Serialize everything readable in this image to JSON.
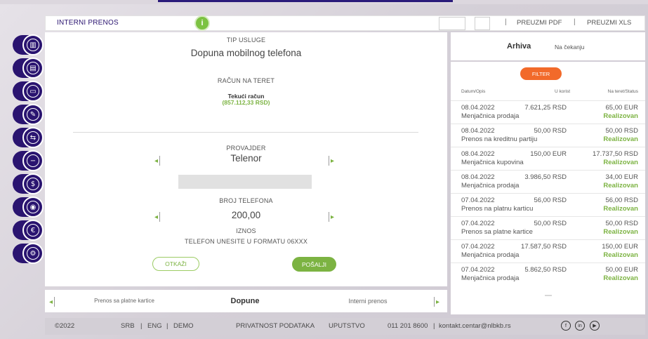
{
  "header": {
    "title": "INTERNI PRENOS",
    "info_icon": "i",
    "separator": "|",
    "download_pdf": "PREUZMI PDF",
    "download_xls": "PREUZMI XLS"
  },
  "form": {
    "service_type_label": "TIP USLUGE",
    "service_type_value": "Dopuna mobilnog telefona",
    "debit_account_label": "RAČUN NA TERET",
    "account_name": "Tekući račun",
    "account_balance": "(857.112,33 RSD)",
    "provider_label": "PROVAJDER",
    "provider_value": "Telenor",
    "phone_label": "BROJ TELEFONA",
    "amount_value": "200,00",
    "amount_label": "IZNOS",
    "phone_hint": "TELEFON UNESITE U FORMATU 06XXX",
    "cancel_label": "OTKAŽI",
    "send_label": "POŠALJI"
  },
  "carousel": {
    "prev_item": "Prenos sa platne kartice",
    "current_item": "Dopune",
    "next_item": "Interni prenos"
  },
  "archive": {
    "tab_active": "Arhiva",
    "tab_inactive": "Na čekanju",
    "filter_label": "FILTER",
    "col_date": "Datum/Opis",
    "col_credit": "U korist",
    "col_debit": "Na teret/Status",
    "transactions": [
      {
        "date": "08.04.2022",
        "credit": "7.621,25 RSD",
        "debit": "65,00 EUR",
        "desc": "Menjačnica prodaja",
        "status": "Realizovan"
      },
      {
        "date": "08.04.2022",
        "credit": "50,00 RSD",
        "debit": "50,00 RSD",
        "desc": "Prenos na kreditnu partiju",
        "status": "Realizovan"
      },
      {
        "date": "08.04.2022",
        "credit": "150,00 EUR",
        "debit": "17.737,50 RSD",
        "desc": "Menjačnica kupovina",
        "status": "Realizovan"
      },
      {
        "date": "08.04.2022",
        "credit": "3.986,50 RSD",
        "debit": "34,00 EUR",
        "desc": "Menjačnica prodaja",
        "status": "Realizovan"
      },
      {
        "date": "07.04.2022",
        "credit": "56,00 RSD",
        "debit": "56,00 RSD",
        "desc": "Prenos na platnu karticu",
        "status": "Realizovan"
      },
      {
        "date": "07.04.2022",
        "credit": "50,00 RSD",
        "debit": "50,00 RSD",
        "desc": "Prenos sa platne kartice",
        "status": "Realizovan"
      },
      {
        "date": "07.04.2022",
        "credit": "17.587,50 RSD",
        "debit": "150,00 EUR",
        "desc": "Menjačnica prodaja",
        "status": "Realizovan"
      },
      {
        "date": "07.04.2022",
        "credit": "5.862,50 RSD",
        "debit": "50,00 EUR",
        "desc": "Menjačnica prodaja",
        "status": "Realizovan"
      }
    ]
  },
  "footer": {
    "copyright": "©2022",
    "lang_srb": "SRB",
    "lang_eng": "ENG",
    "demo": "DEMO",
    "sep": "|",
    "privacy": "PRIVATNOST PODATAKA",
    "instructions": "UPUTSTVO",
    "phone": "011 201 8600",
    "email": "kontakt.centar@nlbkb.rs"
  },
  "sidebar": {
    "icons": [
      "chart-icon",
      "documents-icon",
      "card-icon",
      "pen-icon",
      "transfer-icon",
      "minus-icon",
      "dollar-icon",
      "location-icon",
      "euro-icon",
      "settings-icon"
    ]
  },
  "colors": {
    "brand": "#2a1470",
    "accent_green": "#7cb342",
    "filter_orange": "#f26a2a"
  }
}
